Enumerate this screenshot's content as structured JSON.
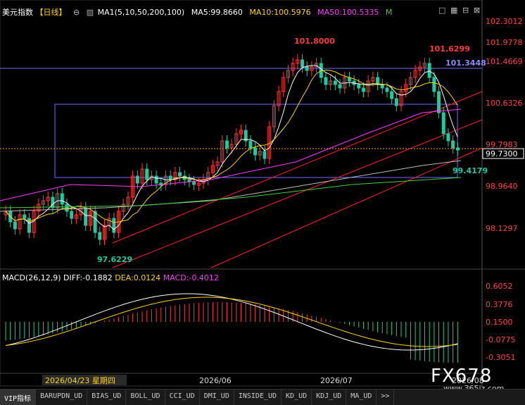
{
  "header": {
    "symbol": "美元指数",
    "period": "【日线】",
    "ma_name": "MA1(5,10,50,200,100)",
    "ma5": "MA5:99.8660",
    "ma10": "MA10:100.5976",
    "ma50": "MA50:100.5335",
    "flag": "M"
  },
  "macd_header": {
    "name": "MACD(26,12,9)",
    "diff": "DIFF:-0.1882",
    "dea": "DEA:0.0124",
    "macd": "MACD:-0.4012"
  },
  "price_axis": [
    "102.3012",
    "101.9778",
    "101.4669",
    "100.6326",
    "99.7983",
    "99.7300",
    "98.9640",
    "98.1297"
  ],
  "macd_axis": [
    "0.6052",
    "0.3776",
    "0.1500",
    "-0.0775",
    "-0.3051"
  ],
  "annotations": {
    "high1": "101.8000",
    "high2": "101.6299",
    "line_level": "101.3448",
    "low1": "97.6229",
    "low2": "99.4179"
  },
  "date_axis": {
    "cursor_date": "2026/04/23 星期四",
    "jun": "2026/06",
    "jul": "2026/07",
    "aug": "2026/08"
  },
  "tabs": [
    "VIP指标",
    "BARUPDN_UD",
    "BIAS_UD",
    "BOLL_UD",
    "CCI_UD",
    "DMI_UD",
    "INSIDE_UD",
    "KD_UD",
    "KDJ_UD",
    "MA_UD",
    ">>"
  ],
  "logo": "FX678",
  "site": "www.365jz.com",
  "colors": {
    "up": "#ff3b3b",
    "down": "#22c8a0",
    "ma5": "#ffffff",
    "ma10": "#ffd400",
    "ma50": "#ff3bff",
    "ma100": "#7a7aff",
    "ma200": "#3cd23c",
    "channel": "#ff2020",
    "box": "#6f6fff"
  }
}
